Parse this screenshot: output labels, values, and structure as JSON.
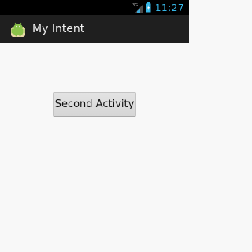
{
  "status_bar": {
    "network_type": "3G",
    "time": "11:27",
    "icons": [
      "signal-icon",
      "battery-icon"
    ],
    "clock_color": "#36b6e6"
  },
  "action_bar": {
    "icon": "android-app-icon",
    "title": "My Intent"
  },
  "main": {
    "button_label": "Second Activity"
  },
  "colors": {
    "action_bar_bg": "#1f1f1f",
    "content_bg": "#f8f8f8",
    "button_bg": "#dcdcdc"
  }
}
